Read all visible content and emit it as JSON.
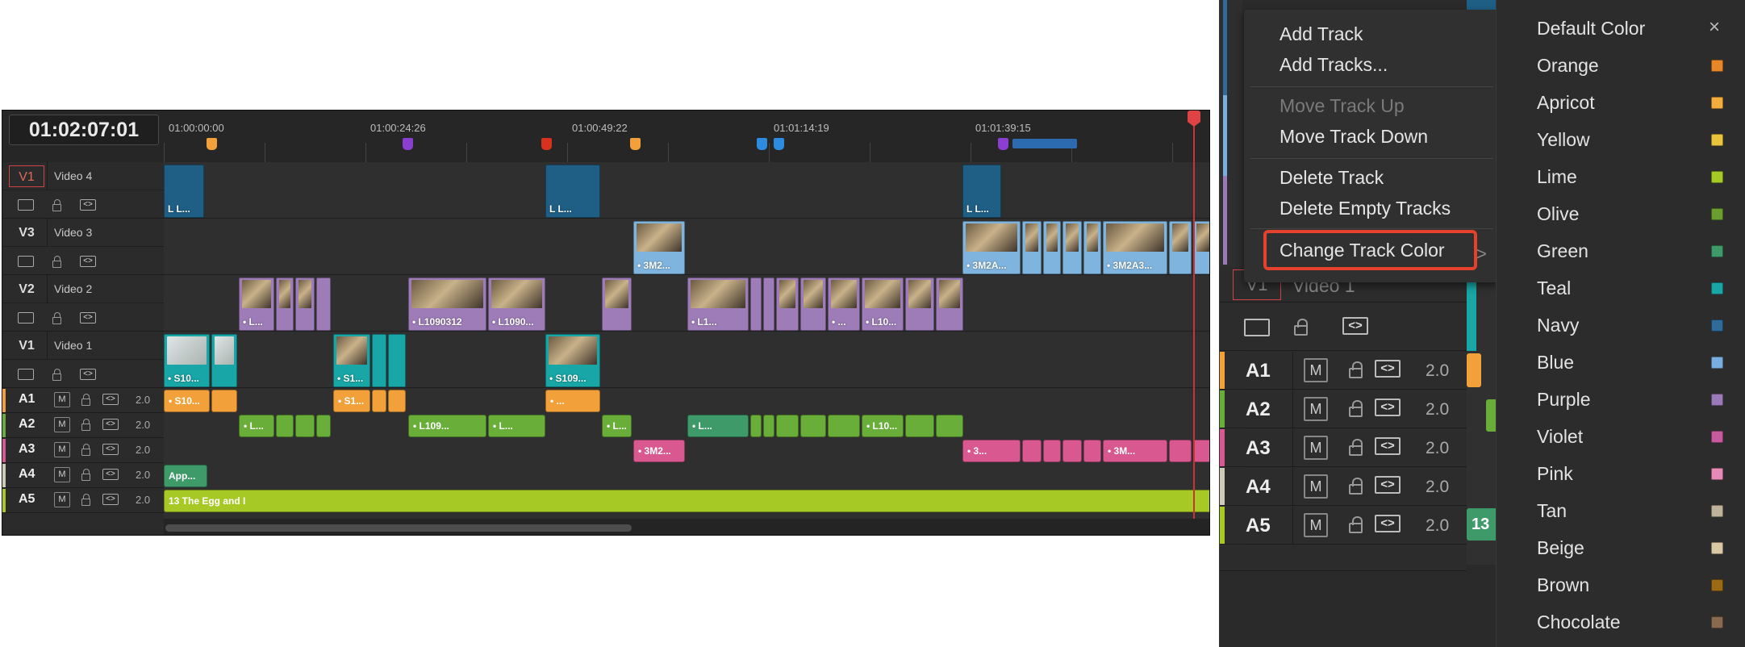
{
  "timeline": {
    "timecode": "01:02:07:01",
    "ruler_labels": [
      "01:00:00:00",
      "01:00:24:26",
      "01:00:49:22",
      "01:01:14:19",
      "01:01:39:15"
    ],
    "video_tracks": [
      {
        "code": "V1",
        "name": "Video 4",
        "selected": true
      },
      {
        "code": "V3",
        "name": "Video 3",
        "selected": false
      },
      {
        "code": "V2",
        "name": "Video 2",
        "selected": false
      },
      {
        "code": "V1",
        "name": "Video 1",
        "selected": false
      }
    ],
    "audio_tracks": [
      {
        "code": "A1",
        "mute": "M",
        "level": "2.0",
        "color": "#f2a13a"
      },
      {
        "code": "A2",
        "mute": "M",
        "level": "2.0",
        "color": "#6aae3a"
      },
      {
        "code": "A3",
        "mute": "M",
        "level": "2.0",
        "color": "#d8588f"
      },
      {
        "code": "A4",
        "mute": "M",
        "level": "2.0",
        "color": "#cfc9b8"
      },
      {
        "code": "A5",
        "mute": "M",
        "level": "2.0",
        "color": "#a7c926"
      }
    ],
    "clip_labels": {
      "v4a": "L L...",
      "v4b": "L L...",
      "v4c": "L L...",
      "v3a": "• 3M2...",
      "v3b": "• 3M2A...",
      "v3c": "• 3M2A3...",
      "v2a": "• L...",
      "v2b": "• L1090312",
      "v2c": "• L1090...",
      "v2d": "• L1...",
      "v2e": "• ...",
      "v2f": "• L10...",
      "v1a": "• S10...",
      "v1b": "• S1...",
      "v1c": "• S109...",
      "a1a": "• S10...",
      "a1b": "• S1...",
      "a1c": "• ...",
      "a2a": "• L...",
      "a2b": "• L109...",
      "a2c": "• L...",
      "a2d": "• L...",
      "a2e": "• L...",
      "a2f": "• L10...",
      "a3a": "• 3M2...",
      "a3b": "• 3...",
      "a3c": "• 3M...",
      "a4a": "App...",
      "a5a": "13 The Egg and I"
    }
  },
  "right_panel": {
    "track_code": "V1",
    "track_name": "Video 1",
    "audio_rows": [
      {
        "code": "A1",
        "mute": "M",
        "level": "2.0",
        "color": "#f2a13a"
      },
      {
        "code": "A2",
        "mute": "M",
        "level": "2.0",
        "color": "#6aae3a"
      },
      {
        "code": "A3",
        "mute": "M",
        "level": "2.0",
        "color": "#d8588f"
      },
      {
        "code": "A4",
        "mute": "M",
        "level": "2.0",
        "color": "#cfc9b8"
      },
      {
        "code": "A5",
        "mute": "M",
        "level": "2.0",
        "color": "#a7c926"
      }
    ],
    "strip_label": "13"
  },
  "context_menu": {
    "add_track": "Add Track",
    "add_tracks": "Add Tracks...",
    "move_up": "Move Track Up",
    "move_down": "Move Track Down",
    "delete_track": "Delete Track",
    "delete_empty": "Delete Empty Tracks",
    "change_color": "Change Track Color"
  },
  "color_menu": {
    "close": "×",
    "items": [
      {
        "label": "Default Color",
        "color": ""
      },
      {
        "label": "Orange",
        "color": "#e8862a"
      },
      {
        "label": "Apricot",
        "color": "#f2ad3d"
      },
      {
        "label": "Yellow",
        "color": "#e8c53a"
      },
      {
        "label": "Lime",
        "color": "#a7c926"
      },
      {
        "label": "Olive",
        "color": "#6a9e2e"
      },
      {
        "label": "Green",
        "color": "#3f9a6a"
      },
      {
        "label": "Teal",
        "color": "#19a6a6"
      },
      {
        "label": "Navy",
        "color": "#2f6a99"
      },
      {
        "label": "Blue",
        "color": "#78aee0"
      },
      {
        "label": "Purple",
        "color": "#9a7ab8"
      },
      {
        "label": "Violet",
        "color": "#c85a9e"
      },
      {
        "label": "Pink",
        "color": "#e88ab8"
      },
      {
        "label": "Tan",
        "color": "#bfb29a"
      },
      {
        "label": "Beige",
        "color": "#d8c9a4"
      },
      {
        "label": "Brown",
        "color": "#9a6a14"
      },
      {
        "label": "Chocolate",
        "color": "#8a6a4e"
      }
    ]
  }
}
